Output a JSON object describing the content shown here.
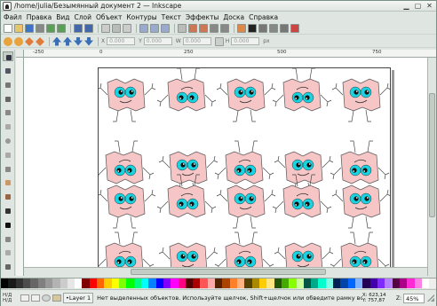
{
  "window": {
    "title": "/home/julia/Безымянный документ 2 — Inkscape"
  },
  "menu": [
    {
      "label": "Файл"
    },
    {
      "label": "Правка"
    },
    {
      "label": "Вид"
    },
    {
      "label": "Слой"
    },
    {
      "label": "Объект"
    },
    {
      "label": "Контуры"
    },
    {
      "label": "Текст"
    },
    {
      "label": "Эффекты"
    },
    {
      "label": "Доска"
    },
    {
      "label": "Справка"
    }
  ],
  "toolbar_main": {
    "icons": [
      "new-icon",
      "open-icon",
      "save-icon",
      "print-icon",
      "import-icon",
      "export-icon",
      "undo-icon",
      "redo-icon",
      "copy-icon",
      "cut-icon",
      "paste-icon",
      "zoom-selection-icon",
      "zoom-drawing-icon",
      "zoom-page-icon",
      "duplicate-icon",
      "clone-icon",
      "unlink-clone-icon",
      "group-icon",
      "ungroup-icon",
      "fill-stroke-icon",
      "text-font-icon",
      "xml-editor-icon",
      "align-icon",
      "preferences-icon",
      "document-props-icon"
    ]
  },
  "toolbar_controls": {
    "x_label": "X",
    "x_value": "0.000",
    "y_label": "Y",
    "y_value": "0.000",
    "w_label": "W",
    "w_value": "0.000",
    "h_label": "H",
    "h_value": "0.000",
    "unit": "px"
  },
  "tools": [
    "selector-icon",
    "node-icon",
    "tweak-icon",
    "zoom-icon",
    "rectangle-icon",
    "3dbox-icon",
    "ellipse-icon",
    "star-icon",
    "spiral-icon",
    "pencil-icon",
    "pen-icon",
    "calligraphy-icon",
    "text-icon",
    "spray-icon",
    "gradient-icon",
    "dropper-icon"
  ],
  "ruler": {
    "labels": [
      {
        "text": "-250"
      },
      {
        "text": "0"
      },
      {
        "text": "250"
      },
      {
        "text": "500"
      },
      {
        "text": "750"
      }
    ]
  },
  "palette": [
    "#000000",
    "#1a1a1a",
    "#333333",
    "#4d4d4d",
    "#666666",
    "#808080",
    "#999999",
    "#b3b3b3",
    "#cccccc",
    "#e6e6e6",
    "#ffffff",
    "#800000",
    "#ff0000",
    "#ff6600",
    "#ffcc00",
    "#ffff00",
    "#80ff00",
    "#00ff00",
    "#00ff80",
    "#00ffff",
    "#0080ff",
    "#0000ff",
    "#8000ff",
    "#ff00ff",
    "#ff0080",
    "#550000",
    "#aa0000",
    "#ff5555",
    "#ffaaaa",
    "#552200",
    "#aa4400",
    "#ff7f2a",
    "#ffb380",
    "#554400",
    "#aa8800",
    "#ffcc00",
    "#ffe680",
    "#225500",
    "#44aa00",
    "#88ff00",
    "#ccff99",
    "#005544",
    "#00aa88",
    "#00ffcc",
    "#80ffe6",
    "#002255",
    "#0044aa",
    "#0066ff",
    "#80b3ff",
    "#220055",
    "#4400aa",
    "#7f2aff",
    "#b380ff",
    "#550044",
    "#aa0088",
    "#ff2ad4",
    "#ff80e5",
    "#ffffff",
    "#eeeeee"
  ],
  "status": {
    "fill_label": "Н/Д",
    "stroke_label": "Н/Д",
    "layer": "•Layer 1",
    "message": "Нет выделенных объектов. Используйте щелчок, Shift+щелчок или обведите рамку во...",
    "x_coord": "X: 623,14",
    "y_coord": "Y: 757,87",
    "zoom": "45%"
  },
  "drawing": {
    "monster_fill": "#f6c5c6",
    "eye_color": "#19d4e0"
  }
}
